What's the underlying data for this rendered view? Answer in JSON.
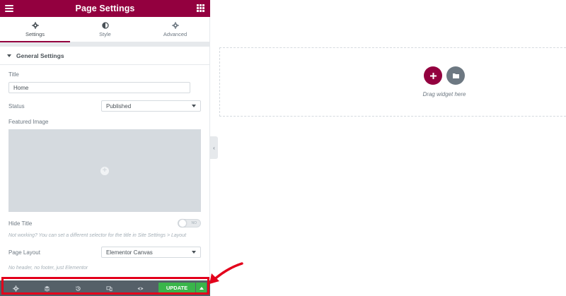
{
  "header": {
    "title": "Page Settings"
  },
  "tabs": [
    {
      "label": "Settings",
      "icon": "gear-icon"
    },
    {
      "label": "Style",
      "icon": "half-circle-icon"
    },
    {
      "label": "Advanced",
      "icon": "cog-icon"
    }
  ],
  "section": {
    "title": "General Settings"
  },
  "fields": {
    "title_label": "Title",
    "title_value": "Home",
    "status_label": "Status",
    "status_value": "Published",
    "featured_image_label": "Featured Image",
    "hide_title_label": "Hide Title",
    "hide_title_toggle": "NO",
    "hide_title_note": "Not working? You can set a different selector for the title in Site Settings > Layout",
    "page_layout_label": "Page Layout",
    "page_layout_value": "Elementor Canvas",
    "page_layout_note": "No header, no footer, just Elementor"
  },
  "footer": {
    "icons": [
      "settings-icon",
      "layers-icon",
      "history-icon",
      "responsive-icon",
      "preview-eye-icon"
    ],
    "update_label": "UPDATE"
  },
  "preview": {
    "drag_text": "Drag widget here"
  },
  "colors": {
    "brand": "#93003f",
    "footer": "#556068",
    "update": "#39b54a",
    "highlight": "#e3001b"
  }
}
